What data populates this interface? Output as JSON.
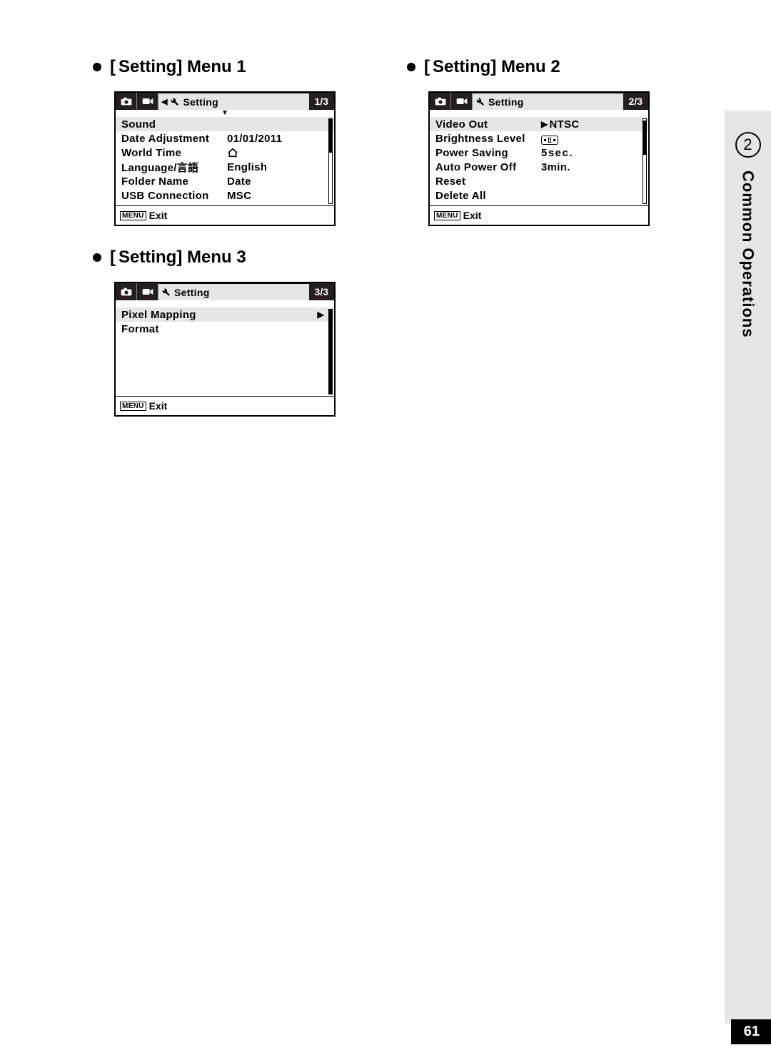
{
  "sidebar": {
    "chapter_number": "2",
    "chapter_title": "Common Operations"
  },
  "page_number": "61",
  "headings": {
    "m1": "Setting] Menu 1",
    "m2": "Setting] Menu 2",
    "m3": "Setting] Menu 3"
  },
  "common": {
    "tab_label": "Setting",
    "footer_menu": "MENU",
    "footer_exit": "Exit"
  },
  "menu1": {
    "page": "1/3",
    "rows": [
      {
        "label": "Sound",
        "value": "",
        "highlighted": true
      },
      {
        "label": "Date Adjustment",
        "value": "01/01/2011"
      },
      {
        "label": "World Time",
        "value": "",
        "icon": "home"
      },
      {
        "label": "Language/言語",
        "value": "English"
      },
      {
        "label": "Folder Name",
        "value": "Date"
      },
      {
        "label": "USB Connection",
        "value": "MSC"
      }
    ]
  },
  "menu2": {
    "page": "2/3",
    "rows": [
      {
        "label": "Video Out",
        "value": "NTSC",
        "caret": true,
        "highlighted": true
      },
      {
        "label": "Brightness Level",
        "value": "",
        "icon": "brightness"
      },
      {
        "label": "Power Saving",
        "value": "5sec."
      },
      {
        "label": "Auto Power Off",
        "value": "3min."
      },
      {
        "label": "Reset",
        "value": ""
      },
      {
        "label": "Delete All",
        "value": ""
      }
    ]
  },
  "menu3": {
    "page": "3/3",
    "rows": [
      {
        "label": "Pixel Mapping",
        "value": "",
        "arrow": true,
        "highlighted": true
      },
      {
        "label": "Format",
        "value": ""
      }
    ]
  }
}
